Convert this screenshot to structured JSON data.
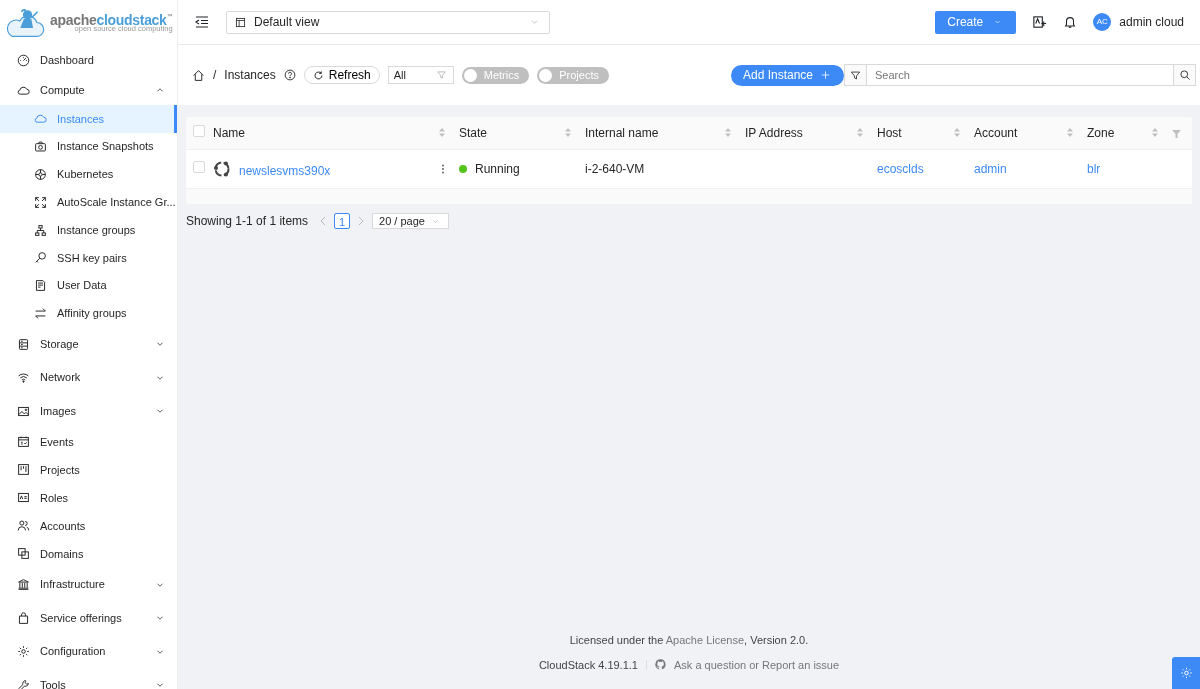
{
  "logo": {
    "word_1": "apache",
    "word_2": "cloudstack",
    "mark": "™",
    "tagline": "open source cloud computing"
  },
  "sidebar": {
    "items": [
      {
        "label": "Dashboard",
        "selected": false
      },
      {
        "label": "Compute",
        "selected": false,
        "expanded": true,
        "children": [
          {
            "label": "Instances",
            "selected": true
          },
          {
            "label": "Instance Snapshots",
            "selected": false
          },
          {
            "label": "Kubernetes",
            "selected": false
          },
          {
            "label": "AutoScale Instance Gr...",
            "selected": false
          },
          {
            "label": "Instance groups",
            "selected": false
          },
          {
            "label": "SSH key pairs",
            "selected": false
          },
          {
            "label": "User Data",
            "selected": false
          },
          {
            "label": "Affinity groups",
            "selected": false
          }
        ]
      },
      {
        "label": "Storage",
        "selected": false,
        "expanded": false
      },
      {
        "label": "Network",
        "selected": false,
        "expanded": false
      },
      {
        "label": "Images",
        "selected": false,
        "expanded": false
      },
      {
        "label": "Events",
        "selected": false
      },
      {
        "label": "Projects",
        "selected": false
      },
      {
        "label": "Roles",
        "selected": false
      },
      {
        "label": "Accounts",
        "selected": false
      },
      {
        "label": "Domains",
        "selected": false
      },
      {
        "label": "Infrastructure",
        "selected": false,
        "expanded": false
      },
      {
        "label": "Service offerings",
        "selected": false,
        "expanded": false
      },
      {
        "label": "Configuration",
        "selected": false,
        "expanded": false
      },
      {
        "label": "Tools",
        "selected": false,
        "expanded": false
      }
    ]
  },
  "header": {
    "view_select": "Default view",
    "create_button": "Create",
    "user": {
      "initials": "AC",
      "name": "admin cloud"
    }
  },
  "toolbar": {
    "separator": "/",
    "page_title": "Instances",
    "refresh_button": "Refresh",
    "filter_select": "All",
    "toggles": [
      {
        "label": "Metrics",
        "on": false
      },
      {
        "label": "Projects",
        "on": false
      }
    ],
    "add_button": "Add Instance",
    "search": {
      "placeholder": "Search"
    }
  },
  "table": {
    "all_checked": false,
    "columns": [
      "Name",
      "State",
      "Internal name",
      "IP Address",
      "Host",
      "Account",
      "Zone"
    ],
    "rows": [
      {
        "checked": false,
        "name": "newslesvms390x",
        "state": "Running",
        "color": "#52c41a",
        "internal_name": "i-2-640-VM",
        "host": "ecosclds",
        "account": "admin",
        "zone": "blr"
      }
    ]
  },
  "pagination": {
    "summary": "Showing 1-1 of 1 items",
    "pages": [
      {
        "label": "1",
        "selected": true
      }
    ],
    "page_size": "20 / page"
  },
  "footer": {
    "license_prefix": "Licensed under the ",
    "license_link": "Apache License",
    "license_suffix": ", Version 2.0.",
    "version": "CloudStack 4.19.1.1",
    "support_link": "Ask a question or Report an issue"
  }
}
